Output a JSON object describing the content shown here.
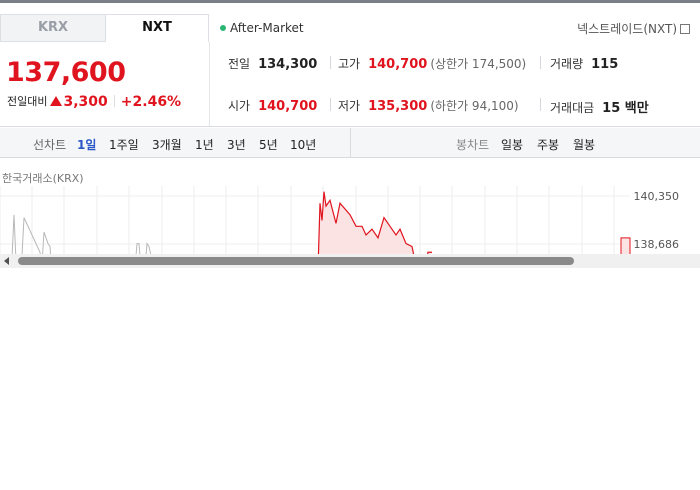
{
  "tabs": [
    {
      "label": "KRX",
      "active": false
    },
    {
      "label": "NXT",
      "active": true
    }
  ],
  "session": {
    "label": "After-Market",
    "dot_color": "#2bb673"
  },
  "market_link": {
    "label": "넥스트레이드(NXT)",
    "icon": "external-link-icon"
  },
  "quote": {
    "price": "137,600",
    "change_label": "전일대비",
    "change_direction": "up",
    "change_amount": "3,300",
    "change_rate": "+2.46%"
  },
  "stats": {
    "prev_close": {
      "label": "전일",
      "value": "134,300"
    },
    "high": {
      "label": "고가",
      "value": "140,700",
      "limit": "(상한가 174,500)"
    },
    "volume": {
      "label": "거래량",
      "value": "115"
    },
    "open": {
      "label": "시가",
      "value": "140,700"
    },
    "low": {
      "label": "저가",
      "value": "135,300",
      "limit": "(하한가 94,100)"
    },
    "turnover": {
      "label": "거래대금",
      "value": "15 백만"
    }
  },
  "period_bar": {
    "line_chart_label": "선차트",
    "line_periods": [
      {
        "label": "1일",
        "active": true
      },
      {
        "label": "1주일",
        "active": false
      },
      {
        "label": "3개월",
        "active": false
      },
      {
        "label": "1년",
        "active": false
      },
      {
        "label": "3년",
        "active": false
      },
      {
        "label": "5년",
        "active": false
      },
      {
        "label": "10년",
        "active": false
      }
    ],
    "candle_chart_label": "봉차트",
    "candle_periods": [
      {
        "label": "일봉"
      },
      {
        "label": "주봉"
      },
      {
        "label": "월봉"
      }
    ]
  },
  "chart": {
    "exchange_label": "한국거래소(KRX)",
    "y_ticks": [
      "140,350",
      "138,686"
    ],
    "colors": {
      "krx_line": "#b8b8b8",
      "nxt_line": "#e0141e",
      "nxt_fill": "#fbe3e4"
    }
  },
  "chart_data": {
    "type": "line",
    "title": "",
    "xlabel": "",
    "ylabel": "",
    "y_tick_labels": [
      "140,350",
      "138,686"
    ],
    "series": [
      {
        "values": [
          138200,
          139700,
          138100,
          138000,
          138300,
          139600,
          138400,
          138000,
          139100,
          138900,
          138700,
          138600,
          137600
        ]
      },
      {
        "values": [
          137800,
          140100,
          139500,
          140500,
          140000,
          140200,
          139400,
          140100,
          139700,
          139300,
          139300,
          139000,
          139200,
          138900,
          139600,
          139300,
          139000,
          139200,
          138700,
          138600,
          137600,
          137600,
          138400,
          138400
        ]
      }
    ]
  }
}
